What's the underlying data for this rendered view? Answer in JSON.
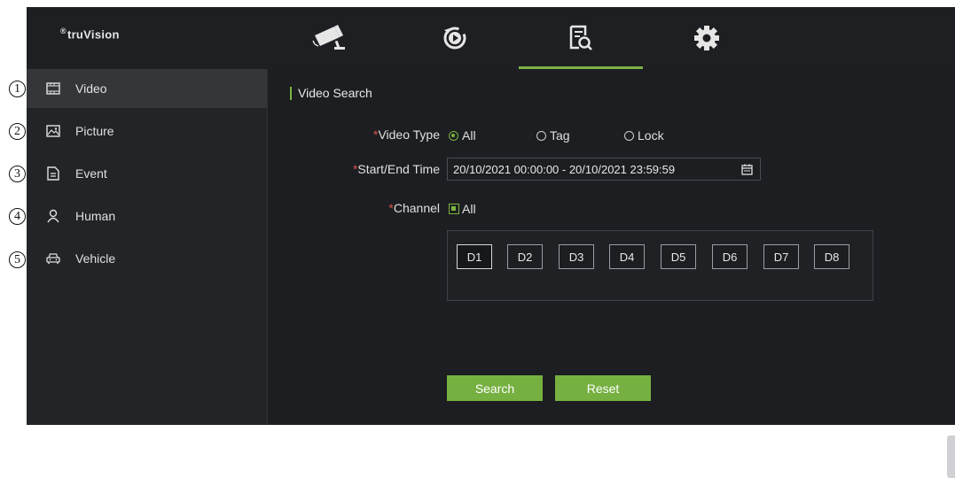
{
  "brand": {
    "registered": "®",
    "name": "truVision"
  },
  "nav": {
    "tabs": [
      {
        "icon": "camera-icon",
        "active": false
      },
      {
        "icon": "playback-icon",
        "active": false
      },
      {
        "icon": "search-file-icon",
        "active": true
      },
      {
        "icon": "gear-icon",
        "active": false
      }
    ]
  },
  "sidebar": {
    "items": [
      {
        "label": "Video",
        "icon": "film-icon",
        "callout": "1",
        "active": true
      },
      {
        "label": "Picture",
        "icon": "image-icon",
        "callout": "2",
        "active": false
      },
      {
        "label": "Event",
        "icon": "document-icon",
        "callout": "3",
        "active": false
      },
      {
        "label": "Human",
        "icon": "person-icon",
        "callout": "4",
        "active": false
      },
      {
        "label": "Vehicle",
        "icon": "car-icon",
        "callout": "5",
        "active": false
      }
    ]
  },
  "main": {
    "title": "Video Search",
    "video_type": {
      "label": "Video Type",
      "required_mark": "*",
      "options": [
        "All",
        "Tag",
        "Lock"
      ],
      "selected": "All"
    },
    "time": {
      "label": "Start/End Time",
      "required_mark": "*",
      "value": "20/10/2021 00:00:00 - 20/10/2021 23:59:59"
    },
    "channel": {
      "label": "Channel",
      "required_mark": "*",
      "all_label": "All",
      "all_checked": true,
      "channels": [
        "D1",
        "D2",
        "D3",
        "D4",
        "D5",
        "D6",
        "D7",
        "D8"
      ]
    },
    "search_button": "Search",
    "reset_button": "Reset"
  },
  "colors": {
    "accent": "#7cb342",
    "background": "#1c1e21",
    "sidebar_active": "#34363a",
    "required": "#d9534f"
  }
}
